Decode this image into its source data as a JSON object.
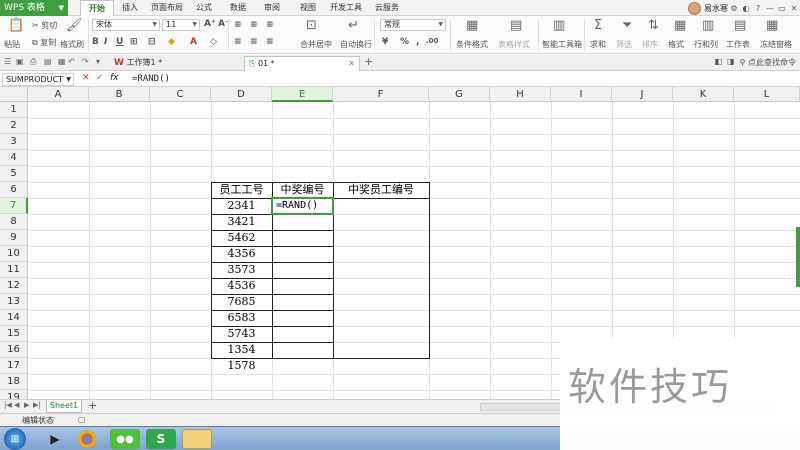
{
  "app": {
    "title": "WPS 表格"
  },
  "menu": {
    "tabs": [
      "开始",
      "插入",
      "页面布局",
      "公式",
      "数据",
      "审阅",
      "视图",
      "开发工具",
      "云服务"
    ],
    "active": "开始"
  },
  "user": {
    "name": "易水寒"
  },
  "ribbon": {
    "paste": "粘贴",
    "cut": "剪切",
    "copy": "复制",
    "format_painter": "格式刷",
    "font_name": "宋体",
    "font_size": "11",
    "merge_center": "合并居中",
    "wrap_text": "自动换行",
    "number_format": "常规",
    "conditional_format": "条件格式",
    "table_style": "表格样式",
    "smart_toolbox": "智能工具箱",
    "sum": "求和",
    "filter": "筛选",
    "sort": "排序",
    "format": "格式",
    "row_col": "行和列",
    "worksheet": "工作表",
    "freeze": "冻结窗格"
  },
  "doc_tabs": [
    {
      "label": "工作簿1 *"
    },
    {
      "label": "01 *"
    }
  ],
  "doc_right": {
    "help": "点此查找命令"
  },
  "formula_bar": {
    "name_box": "SUMPRODUCT",
    "formula": "=RAND()"
  },
  "columns": [
    "A",
    "B",
    "C",
    "D",
    "E",
    "F",
    "G",
    "H",
    "I",
    "J",
    "K",
    "L"
  ],
  "rows": [
    "1",
    "2",
    "3",
    "4",
    "5",
    "6",
    "7",
    "8",
    "9",
    "10",
    "11",
    "12",
    "13",
    "14",
    "15",
    "16",
    "17",
    "18",
    "19"
  ],
  "table": {
    "headers": [
      "员工工号",
      "中奖编号",
      "中奖员工编号"
    ],
    "employee_ids": [
      "2341",
      "3421",
      "5462",
      "4356",
      "3573",
      "4536",
      "7685",
      "6583",
      "5743",
      "1354",
      "1578"
    ],
    "active_cell_value": "=RAND()"
  },
  "sheet_tabs": {
    "sheet": "Sheet1"
  },
  "status": {
    "mode": "编辑状态"
  },
  "watermark": "软件技巧"
}
